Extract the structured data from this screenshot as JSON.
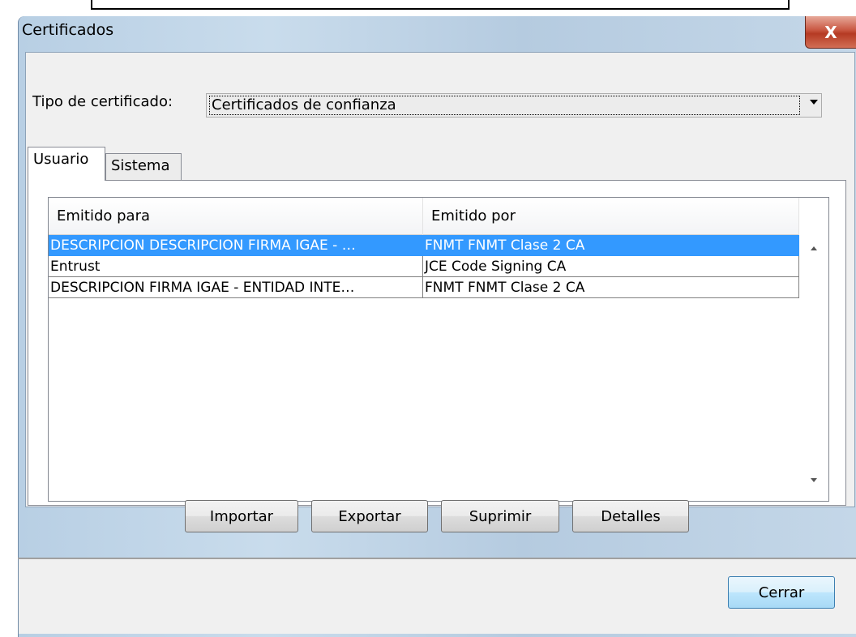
{
  "window": {
    "title": "Certificados",
    "close_glyph": "X"
  },
  "tipo": {
    "label": "Tipo de certificado:",
    "selected": "Certificados de confianza"
  },
  "tabs": [
    {
      "label": "Usuario",
      "active": true
    },
    {
      "label": "Sistema",
      "active": false
    }
  ],
  "table": {
    "columns": [
      "Emitido para",
      "Emitido por"
    ],
    "rows": [
      {
        "para": "DESCRIPCION DESCRIPCION FIRMA IGAE - …",
        "por": "FNMT FNMT Clase 2 CA",
        "selected": true
      },
      {
        "para": "Entrust",
        "por": "JCE Code Signing CA",
        "selected": false
      },
      {
        "para": "DESCRIPCION FIRMA IGAE - ENTIDAD INTE…",
        "por": "FNMT FNMT Clase 2 CA",
        "selected": false
      }
    ]
  },
  "buttons": {
    "importar": "Importar",
    "exportar": "Exportar",
    "suprimir": "Suprimir",
    "detalles": "Detalles",
    "cerrar": "Cerrar"
  },
  "colors": {
    "selection": "#3399ff",
    "close_button": "#c8553f"
  }
}
